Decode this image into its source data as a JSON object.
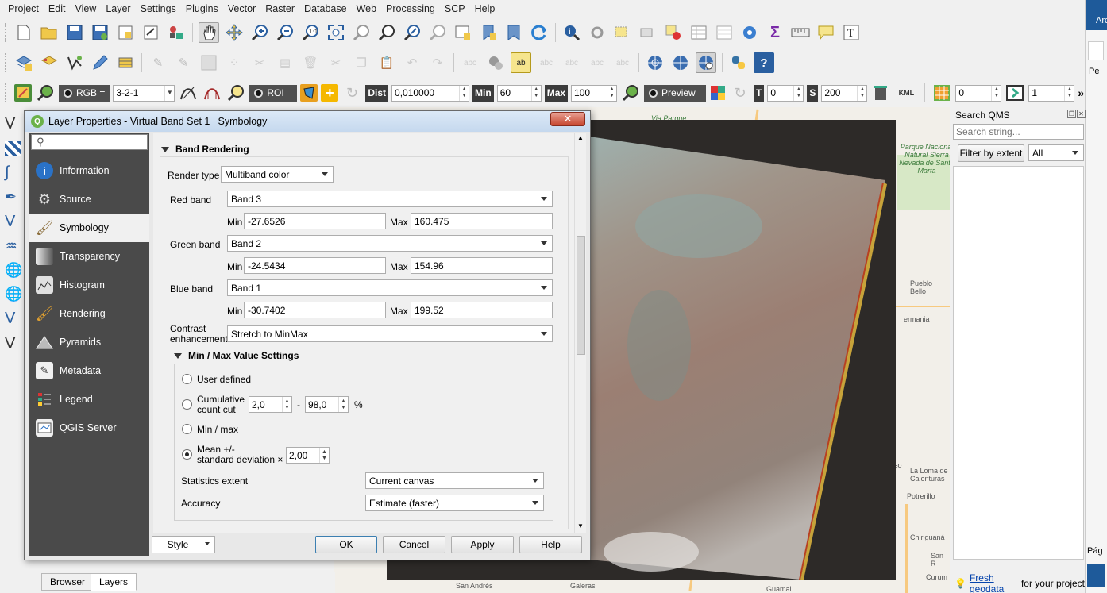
{
  "menubar": {
    "items": [
      "Project",
      "Edit",
      "View",
      "Layer",
      "Settings",
      "Plugins",
      "Vector",
      "Raster",
      "Database",
      "Web",
      "Processing",
      "SCP",
      "Help"
    ]
  },
  "scp_toolbar": {
    "rgb_label": "RGB =",
    "rgb_value": "3-2-1",
    "roi_label": "ROI",
    "dist_label": "Dist",
    "dist_value": "0,010000",
    "min_label": "Min",
    "min_value": "60",
    "max_label": "Max",
    "max_value": "100",
    "preview_label": "Preview",
    "t_label": "T",
    "t_value": "0",
    "s_label": "S",
    "s_value": "200",
    "kml_label": "KML",
    "band_value": "0",
    "step_value": "1",
    "more": "»"
  },
  "far_right": {
    "top_text": "Arc",
    "mid_text": "Pe",
    "bottom_text": "Pág"
  },
  "dialog": {
    "title": "Layer Properties - Virtual Band Set 1 | Symbology",
    "close": "✕",
    "nav": [
      {
        "label": "Information",
        "icon": "information-icon",
        "color": "#2a72c7"
      },
      {
        "label": "Source",
        "icon": "source-icon",
        "color": "#707070"
      },
      {
        "label": "Symbology",
        "icon": "symbology-icon",
        "color": "#8a6d3b"
      },
      {
        "label": "Transparency",
        "icon": "transparency-icon",
        "color": "#606060"
      },
      {
        "label": "Histogram",
        "icon": "histogram-icon",
        "color": "#d0d0d0"
      },
      {
        "label": "Rendering",
        "icon": "rendering-icon",
        "color": "#c99a3c"
      },
      {
        "label": "Pyramids",
        "icon": "pyramids-icon",
        "color": "#9a9a9a"
      },
      {
        "label": "Metadata",
        "icon": "metadata-icon",
        "color": "#e8e8e8"
      },
      {
        "label": "Legend",
        "icon": "legend-icon",
        "color": "#c44"
      },
      {
        "label": "QGIS Server",
        "icon": "qgis-server-icon",
        "color": "#6b8fc5"
      }
    ],
    "band_rendering": {
      "header": "Band Rendering",
      "render_type_label": "Render type",
      "render_type": "Multiband color",
      "red_label": "Red band",
      "red_band": "Band 3",
      "red_min": "-27.6526",
      "red_max": "160.475",
      "green_label": "Green band",
      "green_band": "Band 2",
      "green_min": "-24.5434",
      "green_max": "154.96",
      "blue_label": "Blue band",
      "blue_band": "Band 1",
      "blue_min": "-30.7402",
      "blue_max": "199.52",
      "min_label": "Min",
      "max_label": "Max",
      "contrast_label_1": "Contrast",
      "contrast_label_2": "enhancement",
      "contrast": "Stretch to MinMax"
    },
    "minmax": {
      "header": "Min / Max Value Settings",
      "user_defined": "User defined",
      "cumulative_1": "Cumulative",
      "cumulative_2": "count cut",
      "cum_low": "2,0",
      "cum_dash": "-",
      "cum_high": "98,0",
      "cum_unit": "%",
      "minmax": "Min / max",
      "mean_1": "Mean +/-",
      "mean_2": "standard deviation ×",
      "std_value": "2,00",
      "selected": "mean",
      "stats_extent_label": "Statistics extent",
      "stats_extent": "Current canvas",
      "accuracy_label": "Accuracy",
      "accuracy": "Estimate (faster)"
    },
    "buttons": {
      "style": "Style",
      "ok": "OK",
      "cancel": "Cancel",
      "apply": "Apply",
      "help": "Help"
    }
  },
  "qms": {
    "title": "Search QMS",
    "search_placeholder": "Search string...",
    "filter_button": "Filter by extent",
    "filter_value": "All",
    "footer_link": "Fresh geodata",
    "footer_text": " for your project"
  },
  "bottom_tabs": [
    "Browser",
    "Layers"
  ],
  "map_labels": {
    "parque": "Parque Nacional Natural Sierra Nevada de Santa Marta",
    "pueblo_bello": "Pueblo Bello",
    "germania": "ermania",
    "via_parque": "Via Parque",
    "la_loma": "La Loma de Calenturas",
    "potrerillo": "Potrerillo",
    "chiriguana": "Chiriguaná",
    "san_r": "San R",
    "curum": "Curum",
    "san_andres": "San Andrés",
    "galeras": "Galeras",
    "guamal": "Guamal",
    "so": "so"
  }
}
